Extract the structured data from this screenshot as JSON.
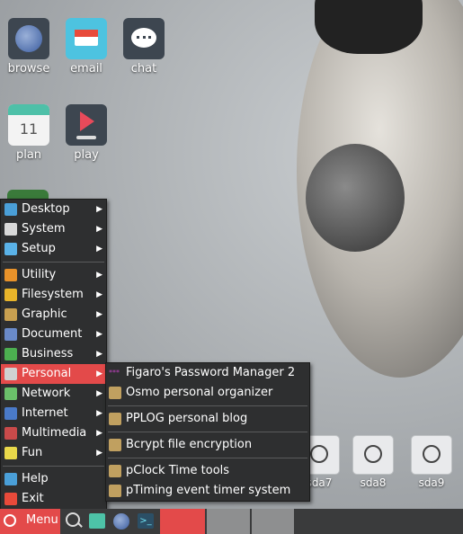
{
  "desktop_icons": [
    {
      "label": "browse",
      "icon": "globe-icon"
    },
    {
      "label": "email",
      "icon": "email-icon"
    },
    {
      "label": "chat",
      "icon": "chat-icon"
    },
    {
      "label": "plan",
      "icon": "calendar-icon",
      "date": "11"
    },
    {
      "label": "play",
      "icon": "play-icon"
    }
  ],
  "drives": [
    {
      "label": "sda7"
    },
    {
      "label": "sda8"
    },
    {
      "label": "sda9"
    }
  ],
  "main_menu": {
    "groups": [
      [
        {
          "label": "Desktop",
          "icon": "desktop-icon",
          "color": "#4a9fd8"
        },
        {
          "label": "System",
          "icon": "system-icon",
          "color": "#d8d8d8"
        },
        {
          "label": "Setup",
          "icon": "setup-gear-icon",
          "color": "#5ab2e8"
        }
      ],
      [
        {
          "label": "Utility",
          "icon": "utility-wrench-icon",
          "color": "#e8922a"
        },
        {
          "label": "Filesystem",
          "icon": "folder-icon",
          "color": "#e8b42a"
        },
        {
          "label": "Graphic",
          "icon": "graphic-icon",
          "color": "#c8a050"
        },
        {
          "label": "Document",
          "icon": "document-icon",
          "color": "#6a8ac8"
        },
        {
          "label": "Business",
          "icon": "business-icon",
          "color": "#4caf50"
        },
        {
          "label": "Personal",
          "icon": "personal-icon",
          "color": "#d0d0d0",
          "active": true
        },
        {
          "label": "Network",
          "icon": "network-icon",
          "color": "#6ac06a"
        },
        {
          "label": "Internet",
          "icon": "internet-globe-icon",
          "color": "#4a7ac8"
        },
        {
          "label": "Multimedia",
          "icon": "multimedia-icon",
          "color": "#c84a4a"
        },
        {
          "label": "Fun",
          "icon": "fun-icon",
          "color": "#e8d84a"
        }
      ],
      [
        {
          "label": "Help",
          "icon": "help-icon",
          "color": "#4a9fd8",
          "noarrow": true
        },
        {
          "label": "Exit",
          "icon": "exit-power-icon",
          "color": "#e84a3a",
          "noarrow": true
        }
      ]
    ]
  },
  "personal_submenu": {
    "groups": [
      [
        {
          "label": "Figaro's Password Manager 2",
          "icon": "password-manager-icon",
          "badge": "***"
        },
        {
          "label": "Osmo personal organizer",
          "icon": "organizer-icon"
        }
      ],
      [
        {
          "label": "PPLOG personal blog",
          "icon": "blog-notebook-icon"
        }
      ],
      [
        {
          "label": "Bcrypt file encryption",
          "icon": "encryption-lock-icon"
        }
      ],
      [
        {
          "label": "pClock Time tools",
          "icon": "clock-icon"
        },
        {
          "label": "pTiming event timer system",
          "icon": "timer-clock-icon"
        }
      ]
    ]
  },
  "taskbar": {
    "menu_label": "Menu",
    "colors": {
      "menu_btn": "#e34a4a",
      "active_task": "#e34a4a",
      "task": "#8e8f90"
    }
  }
}
